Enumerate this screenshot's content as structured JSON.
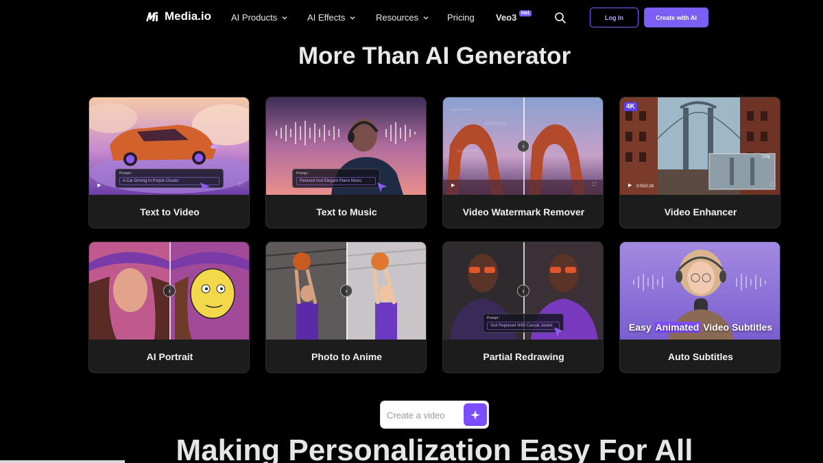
{
  "nav": {
    "brand": "Media.io",
    "items": [
      {
        "label": "AI Products"
      },
      {
        "label": "AI Effects"
      },
      {
        "label": "Resources"
      },
      {
        "label": "Pricing"
      },
      {
        "label": "Veo3"
      }
    ],
    "hot_badge": "Hot",
    "login_label": "Log In",
    "create_label": "Create with AI"
  },
  "section_title": "More Than AI Generator",
  "cards": [
    {
      "label": "Text to Video",
      "prompt_caption": "Prompt :",
      "prompt": "A Car Driving In Purple Clouds"
    },
    {
      "label": "Text to Music",
      "prompt_caption": "Prompt :",
      "prompt": "Relaxed And Elegant Piano Music"
    },
    {
      "label": "Video Watermark Remover"
    },
    {
      "label": "Video Enhancer",
      "badge": "4K",
      "res": "720p",
      "time": "0:05/2:28"
    },
    {
      "label": "AI Portrait"
    },
    {
      "label": "Photo to Anime"
    },
    {
      "label": "Partial Redrawing",
      "prompt_caption": "Prompt :",
      "prompt": "Suit Replaced With Casual Jacket"
    },
    {
      "label": "Auto Subtitles",
      "caption_pre": "Easy ",
      "caption_hl": "Animated",
      "caption_post": " Video Subtitles"
    }
  ],
  "create_input": {
    "placeholder": "Create a video"
  },
  "bottom_title": "Making Personalization Easy For All",
  "colors": {
    "accent": "#7b5ff5",
    "background": "#000000",
    "card": "#1c1c1c"
  }
}
